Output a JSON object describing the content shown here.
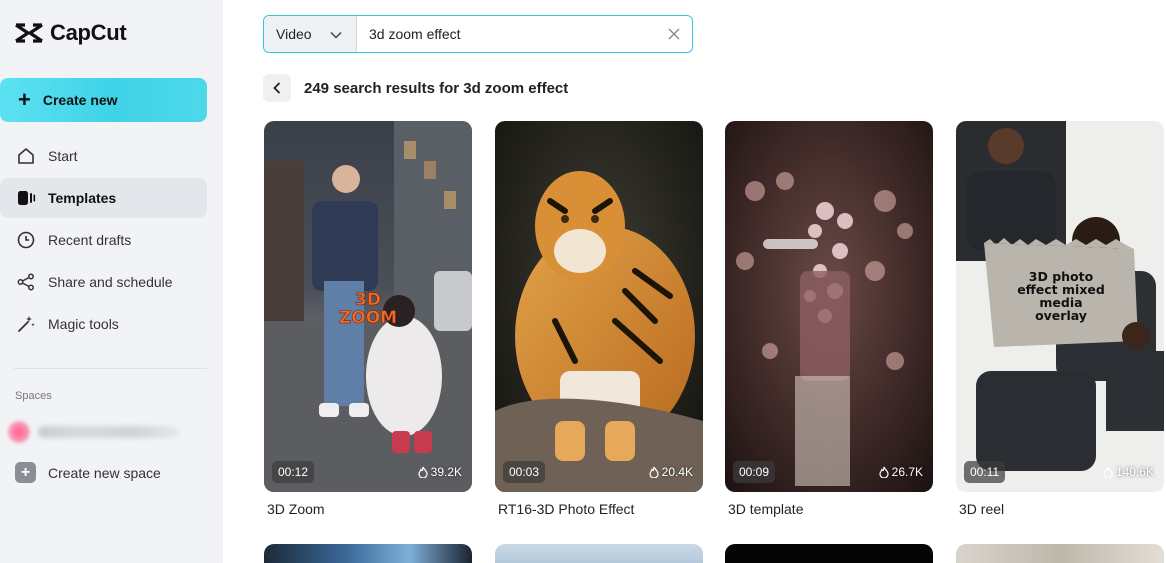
{
  "app": {
    "name": "CapCut"
  },
  "sidebar": {
    "create_label": "Create new",
    "items": [
      {
        "label": "Start",
        "icon": "home-icon"
      },
      {
        "label": "Templates",
        "icon": "templates-icon",
        "active": true
      },
      {
        "label": "Recent drafts",
        "icon": "clock-icon"
      },
      {
        "label": "Share and schedule",
        "icon": "share-icon"
      },
      {
        "label": "Magic tools",
        "icon": "magic-wand-icon"
      }
    ],
    "spaces_label": "Spaces",
    "new_space_label": "Create new space"
  },
  "search": {
    "type_selected": "Video",
    "query": "3d zoom effect"
  },
  "results": {
    "title": "249 search results for 3d zoom effect"
  },
  "templates": [
    {
      "title": "3D Zoom",
      "duration": "00:12",
      "uses": "39.2K",
      "overlay_line1": "3D",
      "overlay_line2": "ZOOM"
    },
    {
      "title": "RT16-3D Photo Effect",
      "duration": "00:03",
      "uses": "20.4K"
    },
    {
      "title": "3D template",
      "duration": "00:09",
      "uses": "26.7K"
    },
    {
      "title": "3D reel",
      "duration": "00:11",
      "uses": "140.6K",
      "overlay_lines": [
        "3D photo",
        "effect mixed",
        "media",
        "overlay"
      ]
    }
  ],
  "colors": {
    "accent": "#2ec8d8",
    "create_gradient_start": "#5ce1f2"
  }
}
